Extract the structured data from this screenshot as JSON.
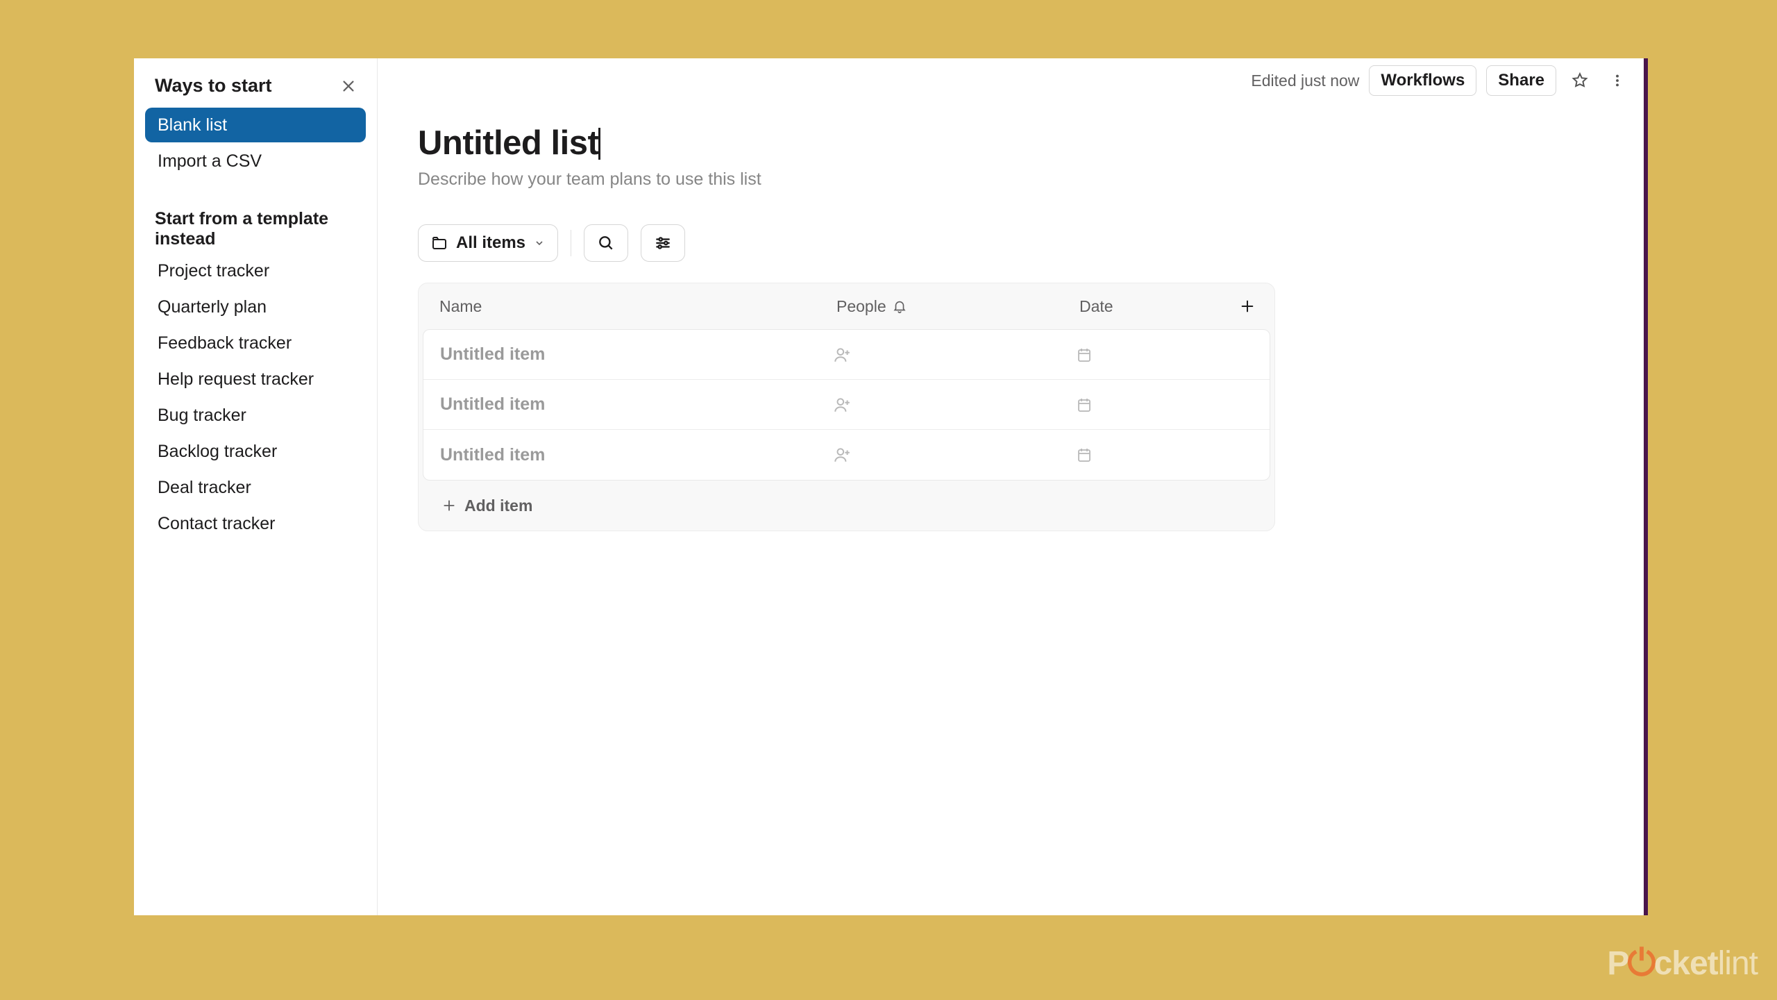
{
  "topbar": {
    "edited": "Edited just now",
    "workflows": "Workflows",
    "share": "Share"
  },
  "sidebar": {
    "header": "Ways to start",
    "items": [
      {
        "label": "Blank list",
        "active": true
      },
      {
        "label": "Import a CSV",
        "active": false
      }
    ],
    "templates_header": "Start from a template instead",
    "templates": [
      "Project tracker",
      "Quarterly plan",
      "Feedback tracker",
      "Help request tracker",
      "Bug tracker",
      "Backlog tracker",
      "Deal tracker",
      "Contact tracker"
    ]
  },
  "main": {
    "title": "Untitled list",
    "subtitle_placeholder": "Describe how your team plans to use this list",
    "all_items": "All items"
  },
  "table": {
    "columns": {
      "name": "Name",
      "people": "People",
      "date": "Date"
    },
    "rows": [
      {
        "name": "Untitled item"
      },
      {
        "name": "Untitled item"
      },
      {
        "name": "Untitled item"
      }
    ],
    "add_item": "Add item"
  },
  "watermark": {
    "a": "P",
    "b": "cket",
    "c": "lint"
  }
}
